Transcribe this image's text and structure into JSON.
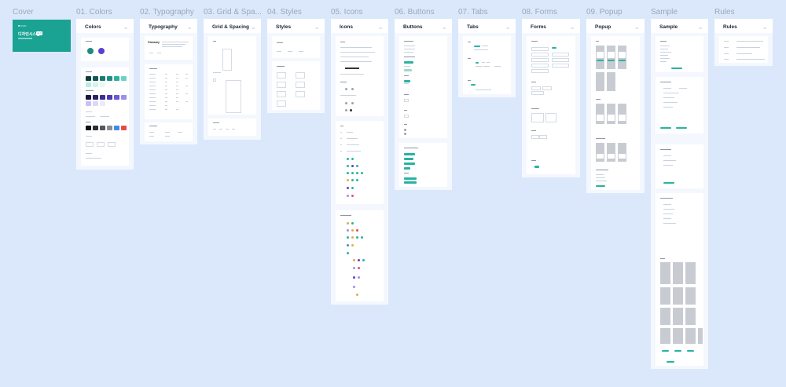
{
  "columns": [
    {
      "title": "Cover"
    },
    {
      "title": "01. Colors"
    },
    {
      "title": "02. Typography"
    },
    {
      "title": "03. Grid & Spa..."
    },
    {
      "title": "04. Styles"
    },
    {
      "title": "05. Icons"
    },
    {
      "title": "06. Buttons"
    },
    {
      "title": "07. Tabs"
    },
    {
      "title": "08. Forms"
    },
    {
      "title": "09. Popup"
    },
    {
      "title": "Sample"
    },
    {
      "title": "Rules"
    }
  ],
  "frames": {
    "colors": "Colors",
    "typography": "Typography",
    "grid": "Grid & Spacing",
    "styles": "Styles",
    "icons": "Icons",
    "buttons": "Buttons",
    "tabs": "Tabs",
    "forms": "Forms",
    "popup": "Popup",
    "sample": "Sample",
    "rules": "Rules"
  },
  "cover": {
    "brand": "■ ••••••",
    "title": "디자인시스템",
    "badge": "v1.0"
  },
  "typography_sample": "Glossary",
  "colors_palette": {
    "primary": [
      "#1f8a7f",
      "#5c3fd0"
    ],
    "teal_row": [
      "#0f3d3a",
      "#145a53",
      "#1b7a70",
      "#1f8f82",
      "#27b3a1",
      "#6fd1c3"
    ],
    "purple_row": [
      "#1c1640",
      "#2c2266",
      "#3b2f8f",
      "#4a3bb3",
      "#6a58d6",
      "#9d90e8"
    ],
    "gray_row": [
      "#111111",
      "#2f2f33",
      "#55575d",
      "#8a8d93",
      "#3a8ee6",
      "#e84a4a"
    ]
  }
}
